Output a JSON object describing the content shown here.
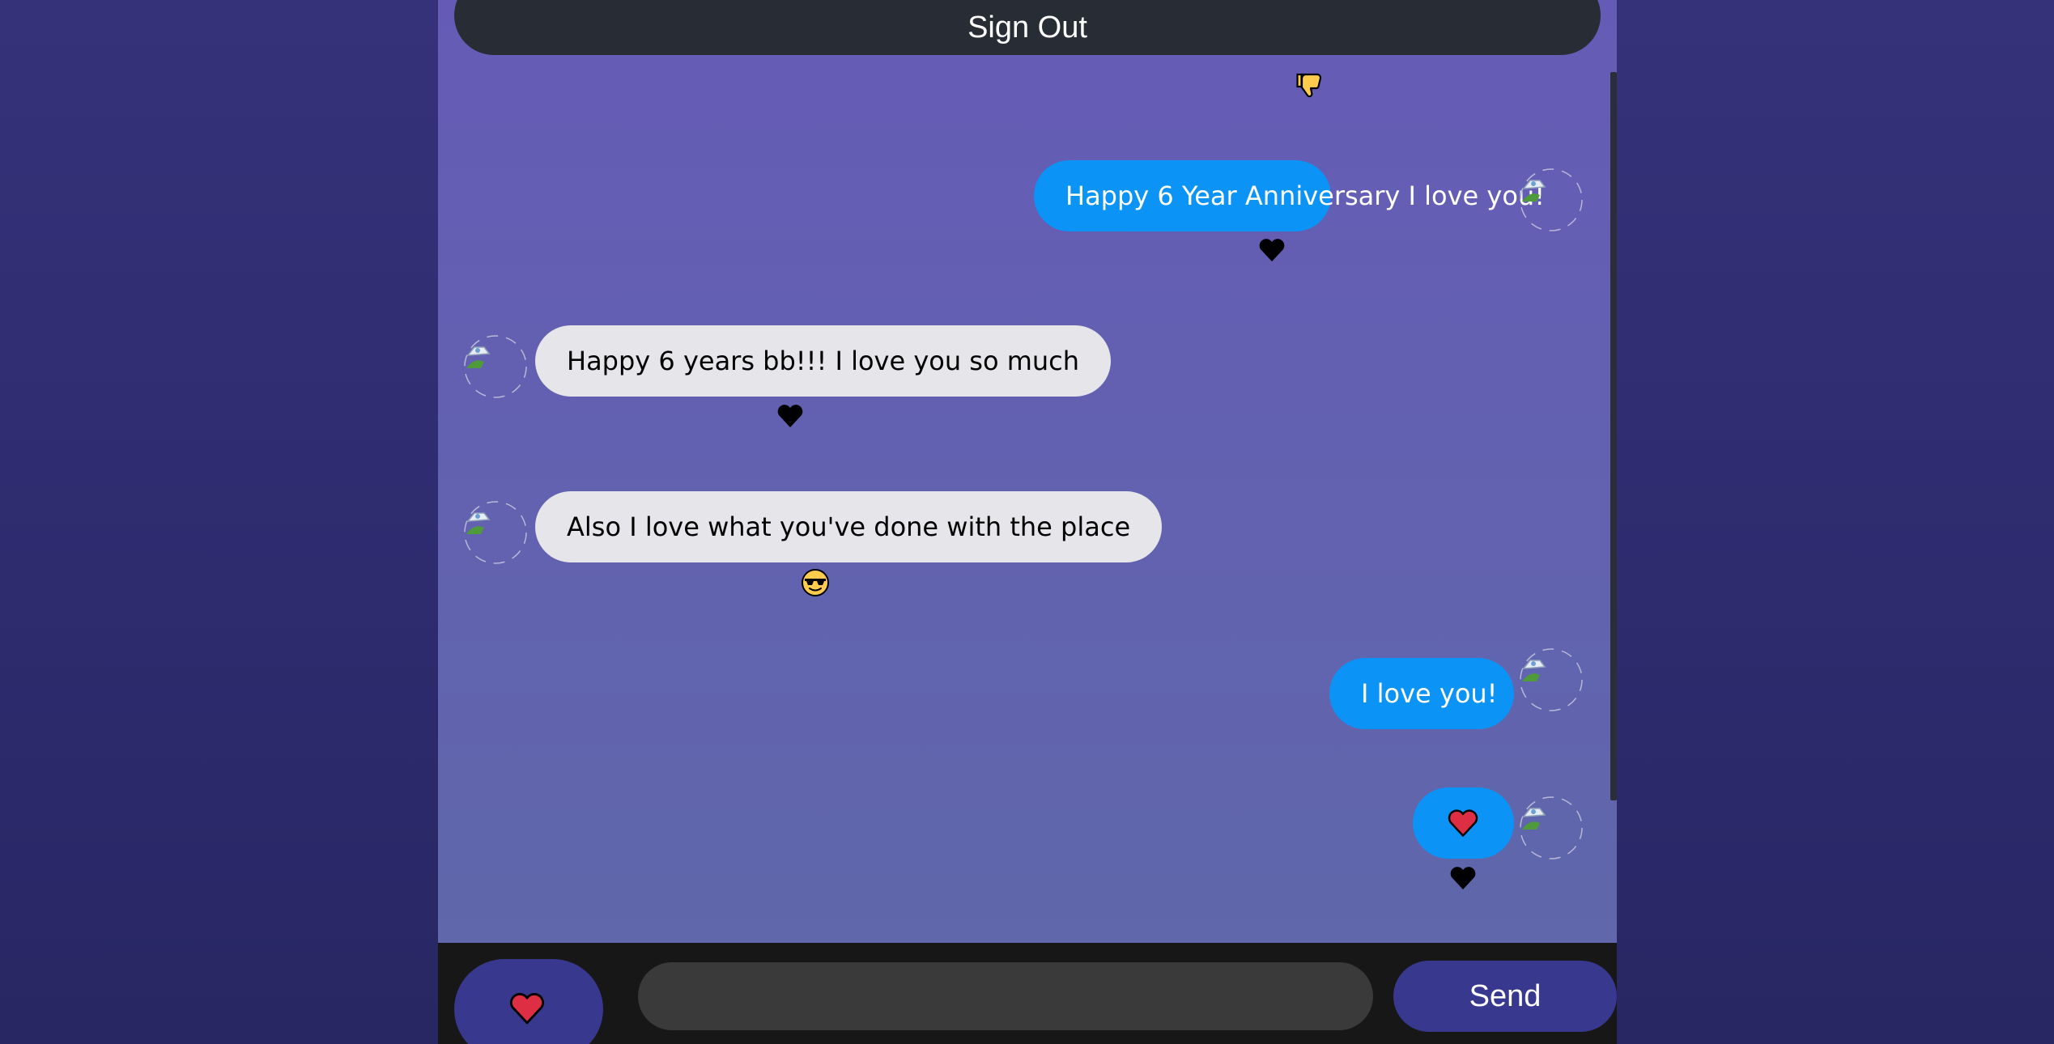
{
  "header": {
    "sign_out_label": "Sign Out"
  },
  "colors": {
    "sent_bubble": "#0b93f6",
    "received_bubble": "#e5e5ea",
    "send_button": "#38388f",
    "footer": "#181717"
  },
  "top_reaction": {
    "icon": "thumbs-down-icon"
  },
  "messages": [
    {
      "direction": "sent",
      "text": "Happy 6 Year Anniversary I love you!",
      "reaction_icon": "black-heart-icon",
      "avatar": "broken-image-avatar"
    },
    {
      "direction": "received",
      "text": "Happy 6 years bb!!! I love you so much",
      "reaction_icon": "black-heart-icon",
      "avatar": "broken-image-avatar"
    },
    {
      "direction": "received",
      "text": "Also I love what you've done with the place",
      "reaction_icon": "sunglasses-face-icon",
      "avatar": "broken-image-avatar"
    },
    {
      "direction": "sent",
      "text": "I love you!",
      "reaction_icon": "",
      "avatar": "broken-image-avatar"
    },
    {
      "direction": "sent",
      "text": "",
      "emoji_icon": "red-heart-icon",
      "reaction_icon": "black-heart-icon",
      "avatar": "broken-image-avatar"
    }
  ],
  "composer": {
    "heart_button_icon": "red-heart-icon",
    "input_value": "",
    "input_placeholder": "",
    "send_label": "Send"
  }
}
